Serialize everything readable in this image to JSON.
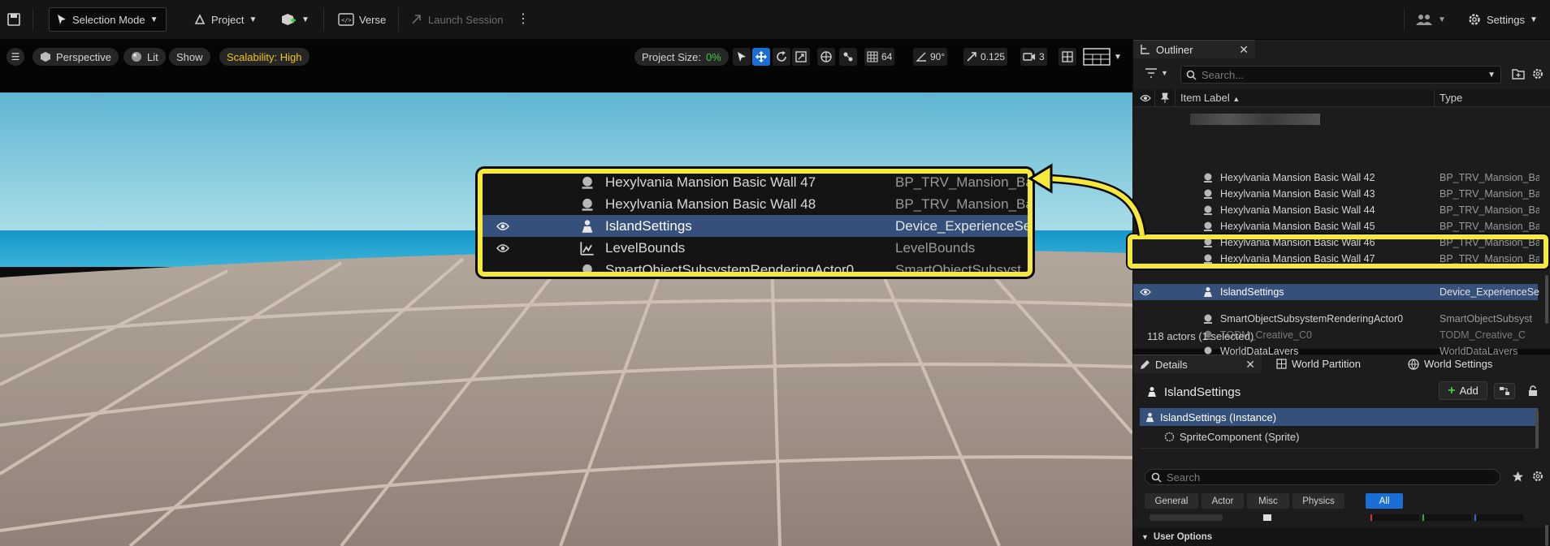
{
  "toolbar": {
    "mode": "Selection Mode",
    "project": "Project",
    "verse": "Verse",
    "launch_session": "Launch Session",
    "settings": "Settings"
  },
  "viewport": {
    "perspective": "Perspective",
    "lit": "Lit",
    "show": "Show",
    "scalability": "Scalability: High",
    "project_size_label": "Project Size:",
    "project_size_value": "0%",
    "grid_snap": "64",
    "angle_snap": "90°",
    "scale_snap": "0.125",
    "camera_speed": "3"
  },
  "outliner": {
    "tab": "Outliner",
    "search_placeholder": "Search...",
    "col_label": "Item Label",
    "col_type": "Type",
    "rows": [
      {
        "label": "Hexylvania Mansion Basic Wall 42",
        "type": "BP_TRV_Mansion_Ba"
      },
      {
        "label": "Hexylvania Mansion Basic Wall 43",
        "type": "BP_TRV_Mansion_Ba"
      },
      {
        "label": "Hexylvania Mansion Basic Wall 44",
        "type": "BP_TRV_Mansion_Ba"
      },
      {
        "label": "Hexylvania Mansion Basic Wall 45",
        "type": "BP_TRV_Mansion_Ba"
      },
      {
        "label": "Hexylvania Mansion Basic Wall 46",
        "type": "BP_TRV_Mansion_Ba"
      },
      {
        "label": "Hexylvania Mansion Basic Wall 47",
        "type": "BP_TRV_Mansion_Ba"
      },
      {
        "label": "IslandSettings",
        "type": "Device_ExperienceSe"
      },
      {
        "label": "SmartObjectSubsystemRenderingActor0",
        "type": "SmartObjectSubsyst"
      },
      {
        "label": "TODM_Creative_C0",
        "type": "TODM_Creative_C"
      },
      {
        "label": "WorldDataLayers",
        "type": "WorldDataLayers"
      }
    ],
    "count": "118 actors (1 selected)"
  },
  "callout": {
    "rows": [
      {
        "label": "Hexylvania Mansion Basic Wall 47",
        "type": "BP_TRV_Mansion_Ba"
      },
      {
        "label": "Hexylvania Mansion Basic Wall 48",
        "type": "BP_TRV_Mansion_Ba"
      },
      {
        "label": "IslandSettings",
        "type": "Device_ExperienceSe"
      },
      {
        "label": "LevelBounds",
        "type": "LevelBounds"
      },
      {
        "label": "SmartObjectSubsystemRenderingActor0",
        "type": "SmartObjectSubsyst"
      }
    ]
  },
  "details": {
    "tab": "Details",
    "tab_world_partition": "World Partition",
    "tab_world_settings": "World Settings",
    "object": "IslandSettings",
    "add": "Add",
    "instance": "IslandSettings (Instance)",
    "component": "SpriteComponent (Sprite)",
    "search_placeholder": "Search",
    "filters": [
      "General",
      "Actor",
      "Misc",
      "Physics",
      "All"
    ],
    "section": "User Options"
  },
  "colors": {
    "highlight": "#f7e93c",
    "selected_row": "#35507a",
    "active_blue": "#1a6fd6",
    "scalability": "#f0c419",
    "project_size_green": "#3fcf3f"
  }
}
